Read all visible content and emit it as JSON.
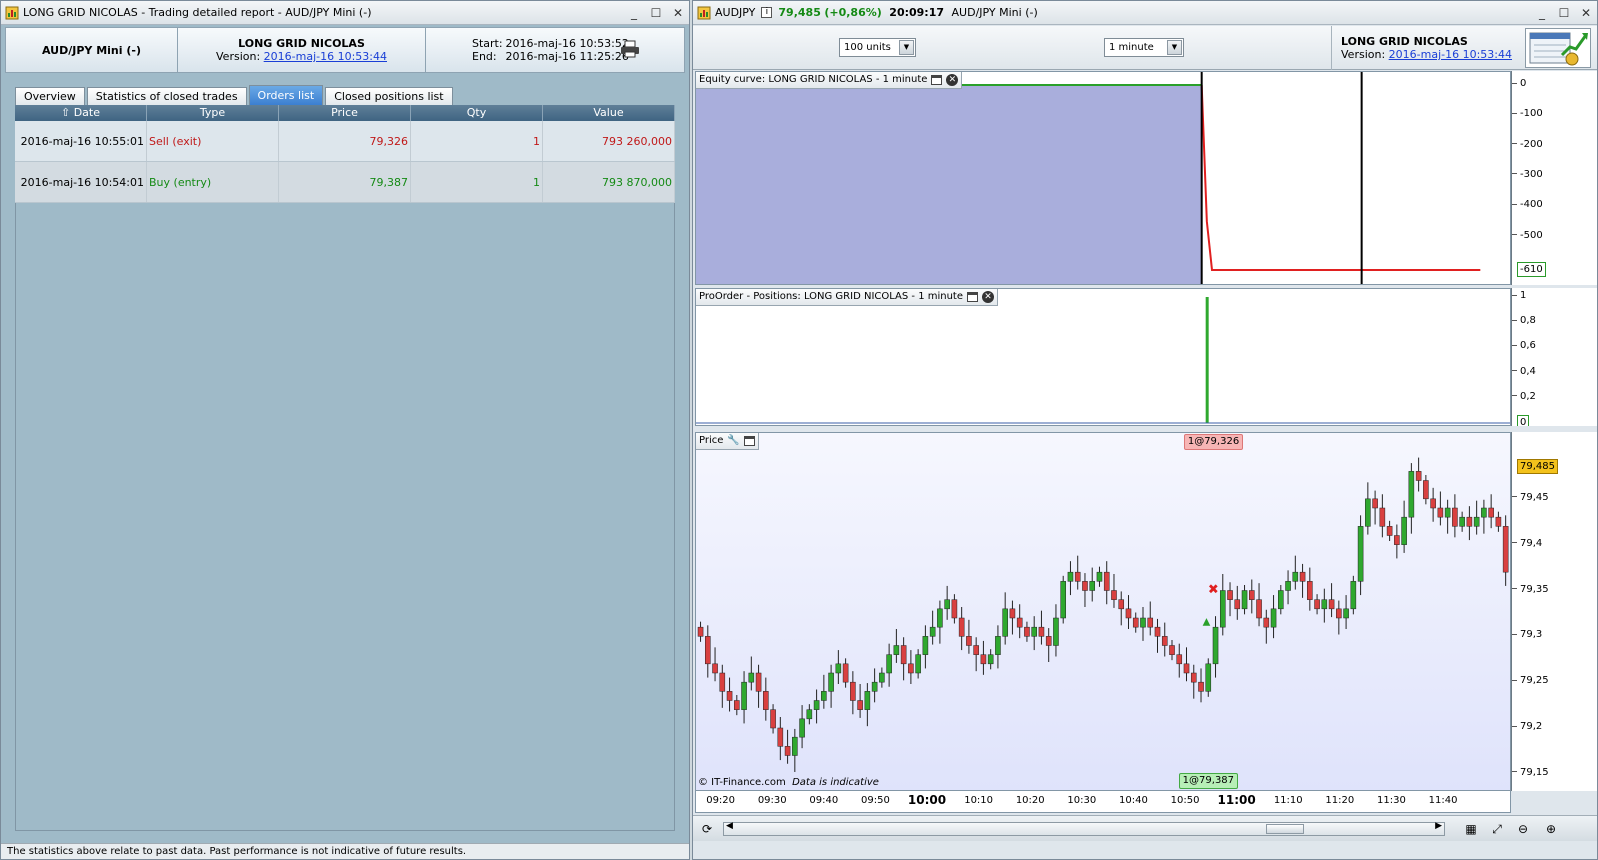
{
  "left_window": {
    "title": "LONG GRID NICOLAS - Trading detailed report - AUD/JPY Mini (-)",
    "instrument": "AUD/JPY Mini (-)",
    "system_name": "LONG GRID NICOLAS",
    "version_label": "Version:",
    "version": "2016-maj-16 10:53:44",
    "start_label": "Start:",
    "start": "2016-maj-16 10:53:52",
    "end_label": "End:",
    "end": "2016-maj-16 11:25:26",
    "tabs": [
      "Overview",
      "Statistics of closed trades",
      "Orders list",
      "Closed positions list"
    ],
    "active_tab": "Orders list",
    "columns": [
      "Date",
      "Type",
      "Price",
      "Qty",
      "Value"
    ],
    "rows": [
      {
        "date": "2016-maj-16 10:55:01",
        "type": "Sell (exit)",
        "price": "79,326",
        "qty": "1",
        "value": "793 260,000"
      },
      {
        "date": "2016-maj-16 10:54:01",
        "type": "Buy (entry)",
        "price": "79,387",
        "qty": "1",
        "value": "793 870,000"
      }
    ],
    "status": "The statistics above relate to past data. Past performance is not indicative of future results."
  },
  "right_window": {
    "symbol": "AUDJPY",
    "last_price": "79,485",
    "change": "(+0,86%)",
    "time": "20:09:17",
    "instrument": "AUD/JPY Mini (-)",
    "units_select": "100 units",
    "timeframe_select": "1 minute",
    "system_name": "LONG GRID NICOLAS",
    "version_label": "Version:",
    "version": "2016-maj-16 10:53:44",
    "copyright": "© IT-Finance.com",
    "disclaimer": "Data is indicative",
    "colors": {
      "equity_fill": "#a9aedc",
      "equity_line_flat": "#2aa02a",
      "equity_line_drop": "#e02020",
      "candle_up": "#2fa82f",
      "candle_down": "#d94040"
    }
  },
  "chart_data": [
    {
      "type": "area",
      "title": "Equity curve: LONG GRID NICOLAS - 1 minute",
      "yticks": [
        "0",
        "-100",
        "-200",
        "-300",
        "-400",
        "-500"
      ],
      "last_value": "-610",
      "ylim": [
        -630,
        10
      ],
      "x": [
        "09:16",
        "10:54",
        "10:55",
        "10:56",
        "11:48"
      ],
      "y": [
        0,
        0,
        -450,
        -610,
        -610
      ]
    },
    {
      "type": "bar",
      "title": "ProOrder - Positions: LONG GRID NICOLAS - 1 minute",
      "yticks": [
        "1",
        "0,8",
        "0,6",
        "0,4",
        "0,2"
      ],
      "last_value": "0",
      "ylim": [
        0,
        1
      ],
      "x": [
        "10:54"
      ],
      "values": [
        1
      ]
    },
    {
      "type": "candlestick",
      "title": "Price",
      "yticks": [
        "79,45",
        "79,4",
        "79,35",
        "79,3",
        "79,25",
        "79,2",
        "79,15"
      ],
      "last_value": "79,485",
      "ylim": [
        79.14,
        79.5
      ],
      "xticks": [
        {
          "label": "09:20",
          "bold": false
        },
        {
          "label": "09:30",
          "bold": false
        },
        {
          "label": "09:40",
          "bold": false
        },
        {
          "label": "09:50",
          "bold": false
        },
        {
          "label": "10:00",
          "bold": true
        },
        {
          "label": "10:10",
          "bold": false
        },
        {
          "label": "10:20",
          "bold": false
        },
        {
          "label": "10:30",
          "bold": false
        },
        {
          "label": "10:40",
          "bold": false
        },
        {
          "label": "10:50",
          "bold": false
        },
        {
          "label": "11:00",
          "bold": true
        },
        {
          "label": "11:10",
          "bold": false
        },
        {
          "label": "11:20",
          "bold": false
        },
        {
          "label": "11:30",
          "bold": false
        },
        {
          "label": "11:40",
          "bold": false
        }
      ],
      "close": [
        79.3,
        79.27,
        79.26,
        79.24,
        79.23,
        79.22,
        79.25,
        79.26,
        79.24,
        79.22,
        79.2,
        79.18,
        79.17,
        79.19,
        79.21,
        79.22,
        79.23,
        79.24,
        79.26,
        79.27,
        79.25,
        79.23,
        79.22,
        79.24,
        79.25,
        79.26,
        79.28,
        79.29,
        79.27,
        79.26,
        79.28,
        79.3,
        79.31,
        79.33,
        79.34,
        79.32,
        79.3,
        79.29,
        79.28,
        79.27,
        79.28,
        79.3,
        79.33,
        79.32,
        79.31,
        79.3,
        79.31,
        79.3,
        79.29,
        79.32,
        79.36,
        79.37,
        79.36,
        79.35,
        79.36,
        79.37,
        79.35,
        79.34,
        79.33,
        79.32,
        79.31,
        79.32,
        79.31,
        79.3,
        79.29,
        79.28,
        79.27,
        79.26,
        79.25,
        79.24,
        79.27,
        79.31,
        79.35,
        79.34,
        79.33,
        79.35,
        79.34,
        79.32,
        79.31,
        79.33,
        79.35,
        79.36,
        79.37,
        79.36,
        79.34,
        79.33,
        79.34,
        79.33,
        79.32,
        79.33,
        79.36,
        79.42,
        79.45,
        79.44,
        79.42,
        79.41,
        79.4,
        79.43,
        79.48,
        79.47,
        79.45,
        79.44,
        79.43,
        79.44,
        79.42,
        79.43,
        79.42,
        79.43,
        79.44,
        79.43,
        79.42,
        79.37
      ],
      "annotations": [
        {
          "label": "1@79,326",
          "kind": "sell",
          "x": "10:55"
        },
        {
          "label": "1@79,387",
          "kind": "buy",
          "x": "10:54"
        }
      ]
    }
  ]
}
